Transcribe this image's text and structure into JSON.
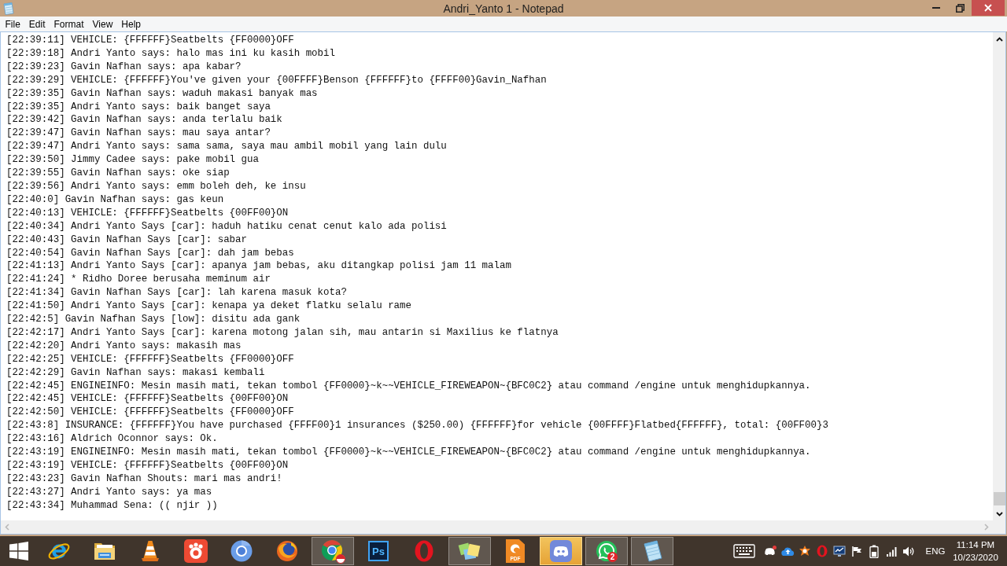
{
  "window": {
    "title": "Andri_Yanto 1 - Notepad"
  },
  "menu": [
    "File",
    "Edit",
    "Format",
    "View",
    "Help"
  ],
  "lines": [
    "[22:39:11] VEHICLE: {FFFFFF}Seatbelts {FF0000}OFF",
    "[22:39:18] Andri Yanto says: halo mas ini ku kasih mobil",
    "[22:39:23] Gavin Nafhan says: apa kabar?",
    "[22:39:29] VEHICLE: {FFFFFF}You've given your {00FFFF}Benson {FFFFFF}to {FFFF00}Gavin_Nafhan",
    "[22:39:35] Gavin Nafhan says: waduh makasi banyak mas",
    "[22:39:35] Andri Yanto says: baik banget saya",
    "[22:39:42] Gavin Nafhan says: anda terlalu baik",
    "[22:39:47] Gavin Nafhan says: mau saya antar?",
    "[22:39:47] Andri Yanto says: sama sama, saya mau ambil mobil yang lain dulu",
    "[22:39:50] Jimmy Cadee says: pake mobil gua",
    "[22:39:55] Gavin Nafhan says: oke siap",
    "[22:39:56] Andri Yanto says: emm boleh deh, ke insu",
    "[22:40:0] Gavin Nafhan says: gas keun",
    "[22:40:13] VEHICLE: {FFFFFF}Seatbelts {00FF00}ON",
    "[22:40:34] Andri Yanto Says [car]: haduh hatiku cenat cenut kalo ada polisi",
    "[22:40:43] Gavin Nafhan Says [car]: sabar",
    "[22:40:54] Gavin Nafhan Says [car]: dah jam bebas",
    "[22:41:13] Andri Yanto Says [car]: apanya jam bebas, aku ditangkap polisi jam 11 malam",
    "[22:41:24] * Ridho Doree berusaha meminum air",
    "[22:41:34] Gavin Nafhan Says [car]: lah karena masuk kota?",
    "[22:41:50] Andri Yanto Says [car]: kenapa ya deket flatku selalu rame",
    "[22:42:5] Gavin Nafhan Says [low]: disitu ada gank",
    "[22:42:17] Andri Yanto Says [car]: karena motong jalan sih, mau antarin si Maxilius ke flatnya",
    "[22:42:20] Andri Yanto says: makasih mas",
    "[22:42:25] VEHICLE: {FFFFFF}Seatbelts {FF0000}OFF",
    "[22:42:29] Gavin Nafhan says: makasi kembali",
    "[22:42:45] ENGINEINFO: Mesin masih mati, tekan tombol {FF0000}~k~~VEHICLE_FIREWEAPON~{BFC0C2} atau command /engine untuk menghidupkannya.",
    "[22:42:45] VEHICLE: {FFFFFF}Seatbelts {00FF00}ON",
    "[22:42:50] VEHICLE: {FFFFFF}Seatbelts {FF0000}OFF",
    "[22:43:8] INSURANCE: {FFFFFF}You have purchased {FFFF00}1 insurances ($250.00) {FFFFFF}for vehicle {00FFFF}Flatbed{FFFFFF}, total: {00FF00}3",
    "[22:43:16] Aldrich Oconnor says: Ok.",
    "[22:43:19] ENGINEINFO: Mesin masih mati, tekan tombol {FF0000}~k~~VEHICLE_FIREWEAPON~{BFC0C2} atau command /engine untuk menghidupkannya.",
    "[22:43:19] VEHICLE: {FFFFFF}Seatbelts {00FF00}ON",
    "[22:43:23] Gavin Nafhan Shouts: mari mas andri!",
    "[22:43:27] Andri Yanto says: ya mas",
    "[22:43:34] Muhammad Sena: (( njir ))"
  ],
  "taskbar": {
    "apps": [
      {
        "kind": "e-globe",
        "running": false,
        "attention": false
      },
      {
        "kind": "folder",
        "running": false,
        "attention": false
      },
      {
        "kind": "cone",
        "running": false,
        "attention": false
      },
      {
        "kind": "paw",
        "running": false,
        "attention": false
      },
      {
        "kind": "ring",
        "running": false,
        "attention": false
      },
      {
        "kind": "fox",
        "running": false,
        "attention": false
      },
      {
        "kind": "tri-ring",
        "running": true,
        "attention": false
      },
      {
        "kind": "tile",
        "text": "Ps",
        "running": false,
        "attention": false
      },
      {
        "kind": "o-ring",
        "running": false,
        "attention": false
      },
      {
        "kind": "notes",
        "running": true,
        "attention": false
      },
      {
        "kind": "doc",
        "text": "PDF",
        "running": false,
        "attention": false
      },
      {
        "kind": "controller",
        "running": true,
        "attention": true
      },
      {
        "kind": "phone",
        "badge": "2",
        "running": true,
        "attention": false
      },
      {
        "kind": "notepad",
        "running": true,
        "attention": false
      }
    ],
    "tray": {
      "language": "ENG",
      "time": "11:14 PM",
      "date": "10/23/2020"
    }
  }
}
